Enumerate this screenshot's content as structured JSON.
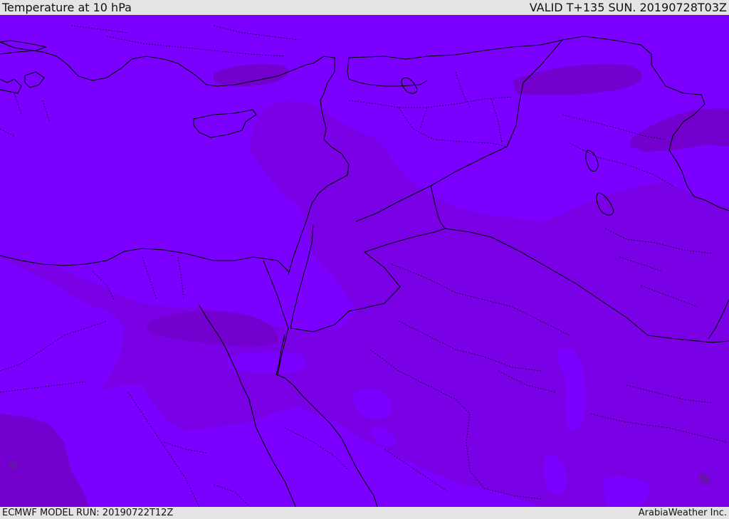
{
  "header": {
    "title": "Temperature at 10 hPa",
    "valid": "VALID T+135 SUN. 20190728T03Z"
  },
  "footer": {
    "model_run": "ECMWF MODEL RUN: 20190722T12Z",
    "credit": "ArabiaWeather Inc."
  },
  "map": {
    "colors": {
      "base": "#7b00ff",
      "shade2": "#7a00e6",
      "shade3": "#7300cf",
      "shade4": "#6a10b3",
      "coast": "#000000"
    }
  }
}
